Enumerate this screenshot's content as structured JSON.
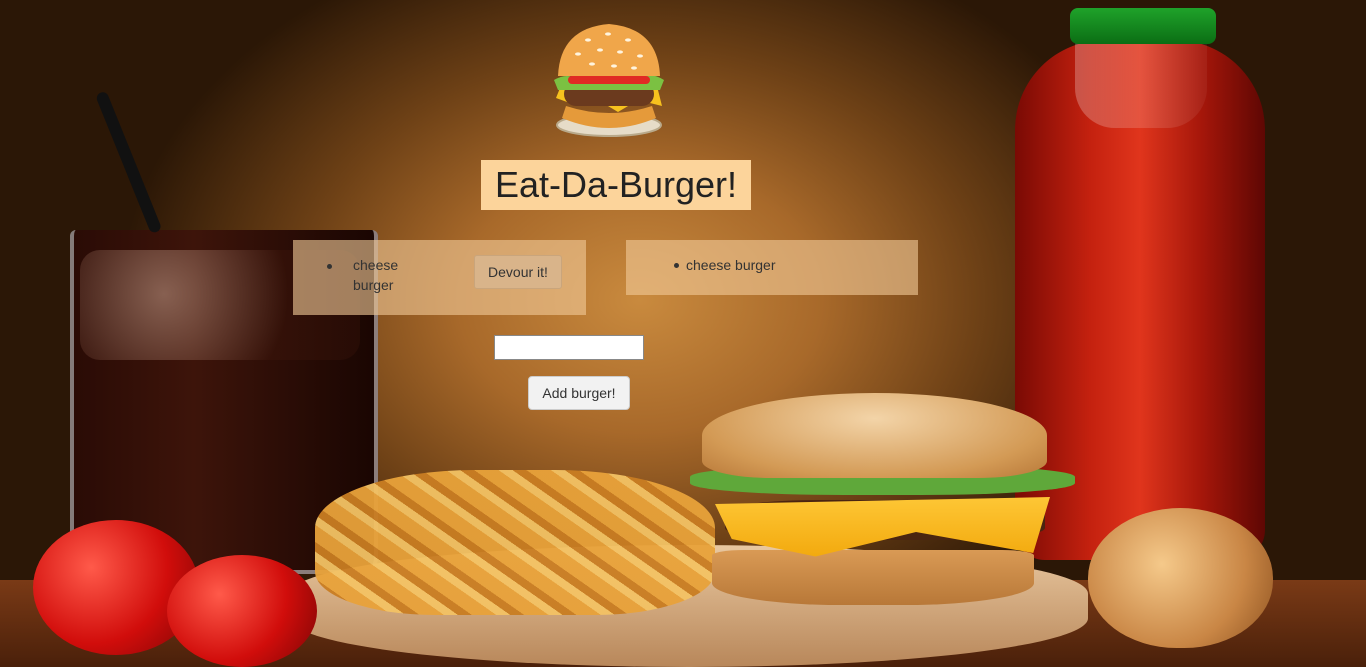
{
  "header": {
    "title": "Eat-Da-Burger!",
    "logo_icon": "burger-icon"
  },
  "uneaten_list": {
    "items": [
      {
        "name": "cheese\nburger",
        "devour_label": "Devour it!"
      }
    ]
  },
  "devoured_list": {
    "items": [
      {
        "name": "cheese burger"
      }
    ]
  },
  "add_form": {
    "input_value": "",
    "input_placeholder": "",
    "submit_label": "Add burger!"
  },
  "colors": {
    "title_background": "#fcd49b",
    "panel_background": "rgba(240,200,150,0.62)",
    "devour_button": "#d9b48a"
  }
}
